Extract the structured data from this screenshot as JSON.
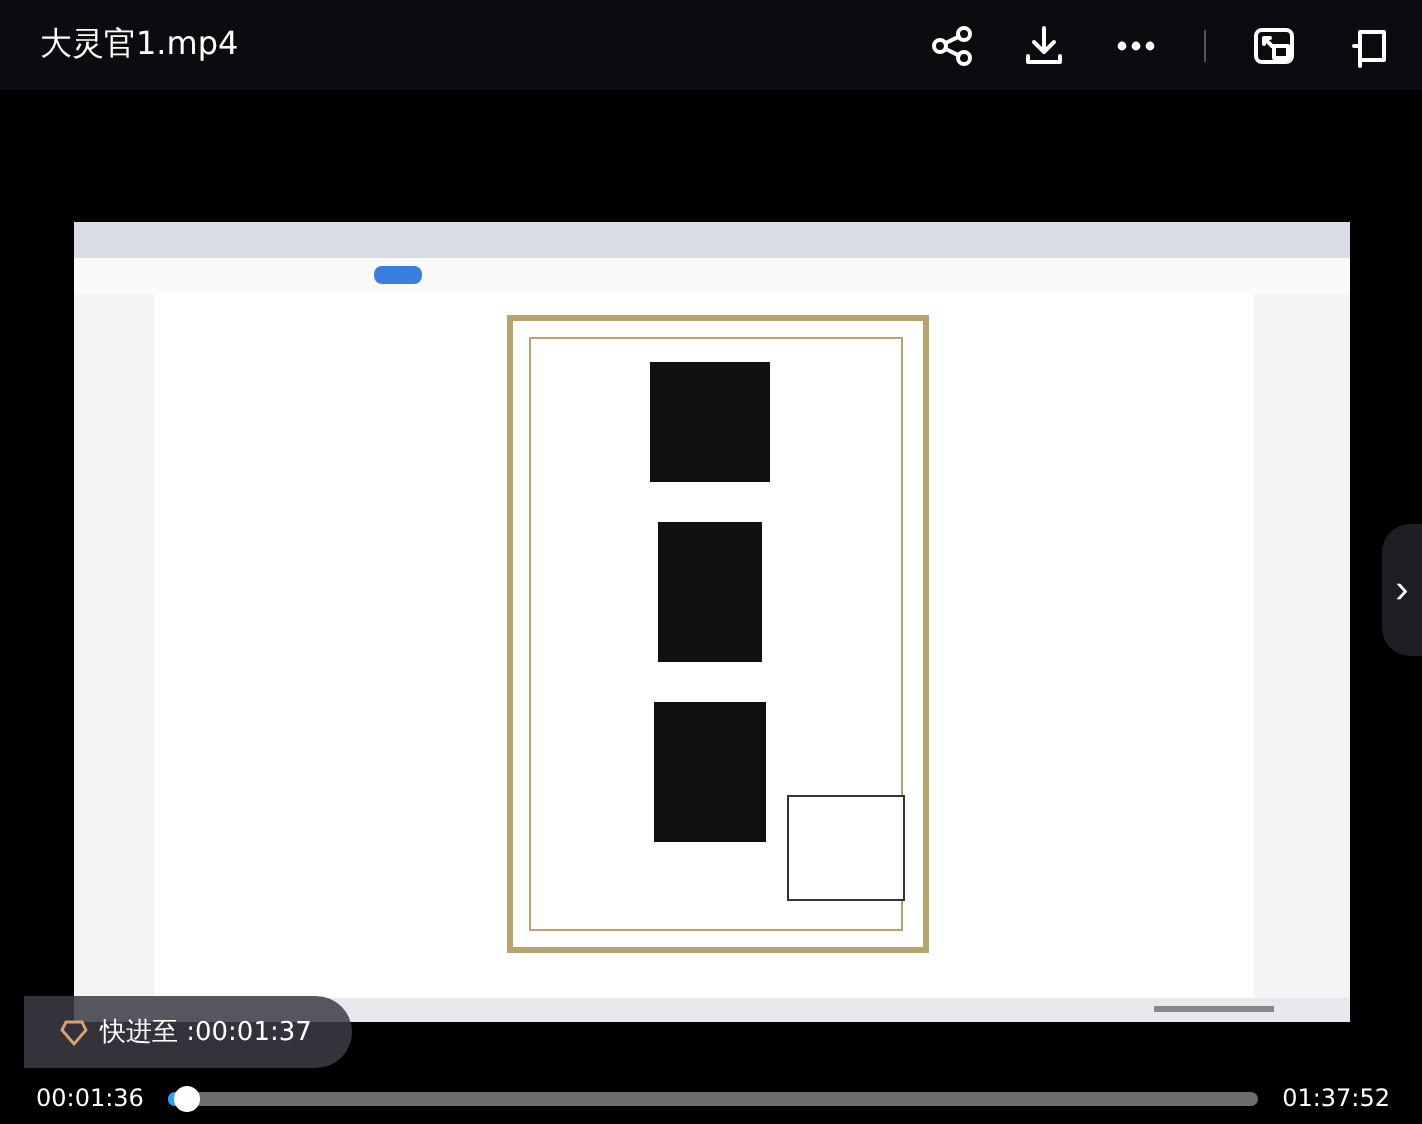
{
  "title": "大灵官1.mp4",
  "toolbar": [
    {
      "kind": "share"
    },
    {
      "kind": "download"
    },
    {
      "kind": "more"
    },
    {
      "kind": "pip"
    },
    {
      "kind": "crop"
    }
  ],
  "toast": {
    "text": "快进至 :00:01:37"
  },
  "side_button": {
    "glyph": "›"
  },
  "playback": {
    "current": "00:01:36",
    "total": "01:37:52",
    "level": 0.016
  }
}
